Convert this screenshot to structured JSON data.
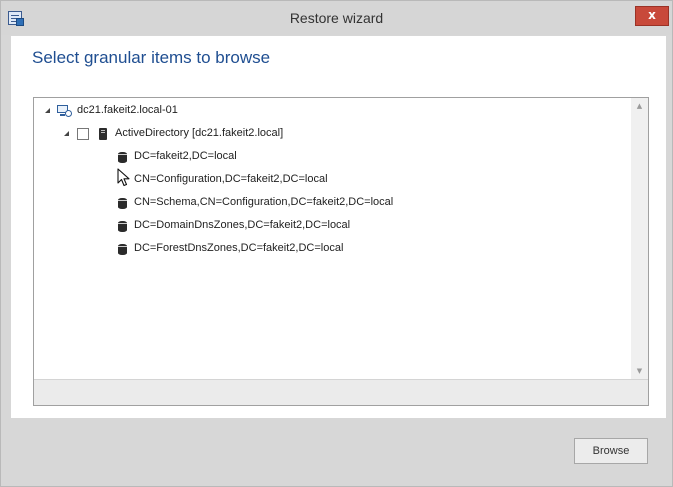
{
  "window": {
    "title": "Restore wizard",
    "close_glyph": "x"
  },
  "page": {
    "heading": "Select granular items to browse"
  },
  "tree": {
    "root": {
      "label": "dc21.fakeit2.local-01",
      "icon": "computer-icon",
      "expanded": true
    },
    "ad": {
      "label": "ActiveDirectory [dc21.fakeit2.local]",
      "icon": "server-icon",
      "checked": false,
      "expanded": true
    },
    "items": [
      {
        "label": "DC=fakeit2,DC=local",
        "icon": "database-icon"
      },
      {
        "label": "CN=Configuration,DC=fakeit2,DC=local",
        "icon": "database-icon"
      },
      {
        "label": "CN=Schema,CN=Configuration,DC=fakeit2,DC=local",
        "icon": "database-icon"
      },
      {
        "label": "DC=DomainDnsZones,DC=fakeit2,DC=local",
        "icon": "database-icon"
      },
      {
        "label": "DC=ForestDnsZones,DC=fakeit2,DC=local",
        "icon": "database-icon"
      }
    ]
  },
  "footer": {
    "browse_label": "Browse"
  },
  "colors": {
    "heading": "#1f4e91",
    "close_button": "#c8493a",
    "chrome": "#d7d7d7"
  }
}
